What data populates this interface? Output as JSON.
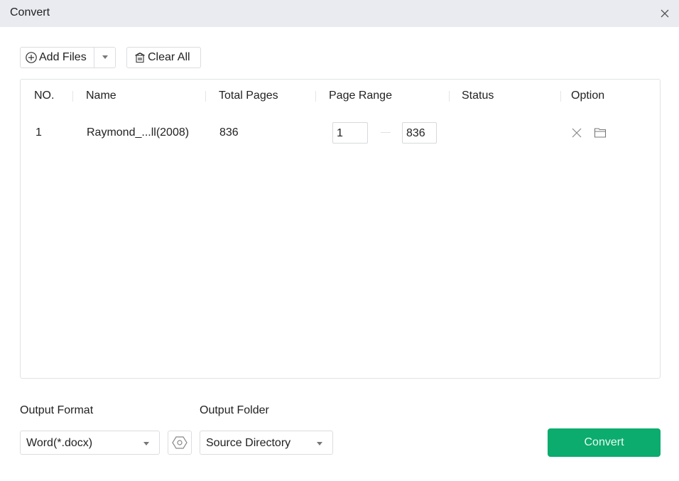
{
  "window": {
    "title": "Convert"
  },
  "toolbar": {
    "add_files_label": "Add Files",
    "clear_all_label": "Clear All"
  },
  "table": {
    "columns": [
      "NO.",
      "Name",
      "Total Pages",
      "Page Range",
      "Status",
      "Option"
    ],
    "rows": [
      {
        "no": "1",
        "name": "Raymond_...ll(2008)",
        "total_pages": "836",
        "range_from": "1",
        "range_to": "836",
        "status": ""
      }
    ]
  },
  "output": {
    "format_label": "Output Format",
    "format_value": "Word(*.docx)",
    "folder_label": "Output Folder",
    "folder_value": "Source Directory"
  },
  "convert_button": {
    "label": "Convert",
    "color": "#0bac6d"
  }
}
